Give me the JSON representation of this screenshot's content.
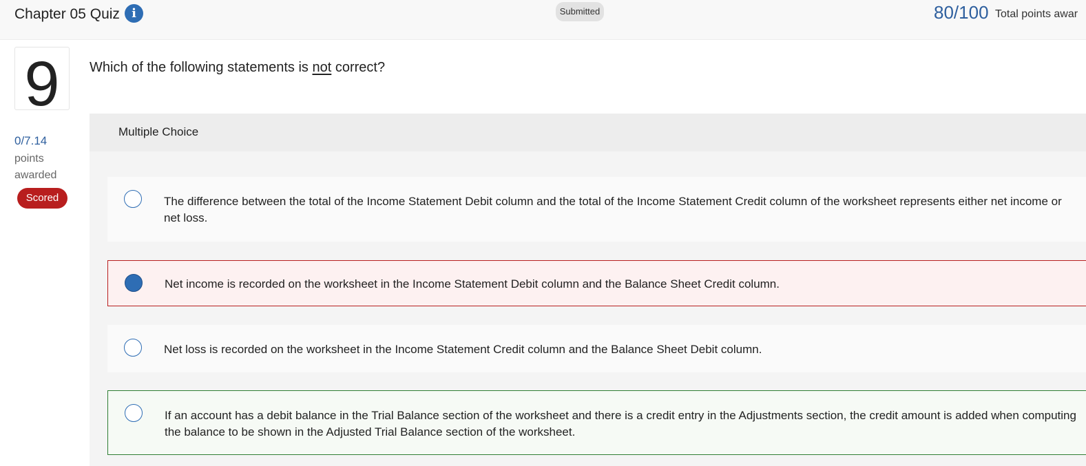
{
  "header": {
    "quiz_title": "Chapter 05 Quiz",
    "info_icon": "info-icon",
    "status": "Submitted",
    "score": "80/100",
    "score_label": "Total points awar"
  },
  "question": {
    "number": "9",
    "points_awarded": "0/7.14",
    "points_label": "points awarded",
    "scored_label": "Scored",
    "text_before": "Which of the following statements is ",
    "text_underlined": "not",
    "text_after": " correct?"
  },
  "panel": {
    "type_label": "Multiple Choice",
    "choices": [
      {
        "text": "The difference between the total of the Income Statement Debit column and the total of the Income Statement Credit column of the worksheet represents either net income or net loss.",
        "selected": false,
        "state": "none"
      },
      {
        "text": "Net income is recorded on the worksheet in the Income Statement Debit column and the Balance Sheet Credit column.",
        "selected": true,
        "state": "incorrect"
      },
      {
        "text": "Net loss is recorded on the worksheet in the Income Statement Credit column and the Balance Sheet Debit column.",
        "selected": false,
        "state": "none"
      },
      {
        "text": "If an account has a debit balance in the Trial Balance section of the worksheet and there is a credit entry in the Adjustments section, the credit amount is added when computing the balance to be shown in the Adjusted Trial Balance section of the worksheet.",
        "selected": false,
        "state": "correct"
      }
    ]
  },
  "colors": {
    "accent": "#2e6db4",
    "score_text": "#2e5f9e",
    "incorrect": "#b81e1e",
    "correct": "#2e7d32"
  }
}
